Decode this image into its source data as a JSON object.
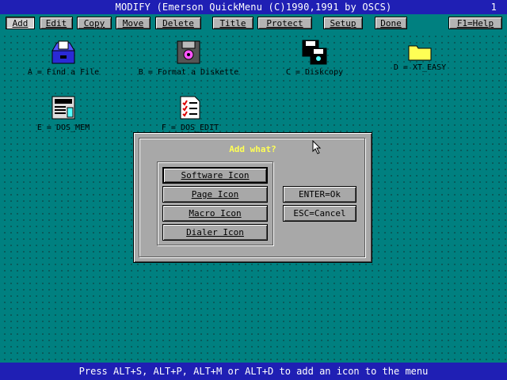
{
  "title": "MODIFY (Emerson QuickMenu (C)1990,1991 by OSCS)",
  "page_number": "1",
  "menu": {
    "add": "Add",
    "edit": "Edit",
    "copy": "Copy",
    "move": "Move",
    "delete": "Delete",
    "title": "Title",
    "protect": "Protect",
    "setup": "Setup",
    "done": "Done",
    "help": "F1=Help"
  },
  "icons": [
    {
      "label": "A = Find a File",
      "icon": "file-box-icon"
    },
    {
      "label": "B = Format a Diskette",
      "icon": "diskette-icon"
    },
    {
      "label": "C = Diskcopy",
      "icon": "diskcopy-icon"
    },
    {
      "label": "D = XT_EASY",
      "icon": "folder-icon"
    },
    {
      "label": "E = DOS_MEM",
      "icon": "computer-icon"
    },
    {
      "label": "F = DOS_EDIT",
      "icon": "checklist-icon"
    }
  ],
  "dialog": {
    "title": "Add what?",
    "software": "Software Icon",
    "page": "Page Icon",
    "macro": "Macro Icon",
    "dialer": "Dialer Icon",
    "ok": "ENTER=Ok",
    "cancel": "ESC=Cancel"
  },
  "status": "Press ALT+S, ALT+P, ALT+M or ALT+D to add an icon to the menu",
  "colors": {
    "desktop": "#008080",
    "titlebar": "#1f1fb4",
    "dialog_title": "#ffff55",
    "button_face": "#b4b4b4"
  }
}
